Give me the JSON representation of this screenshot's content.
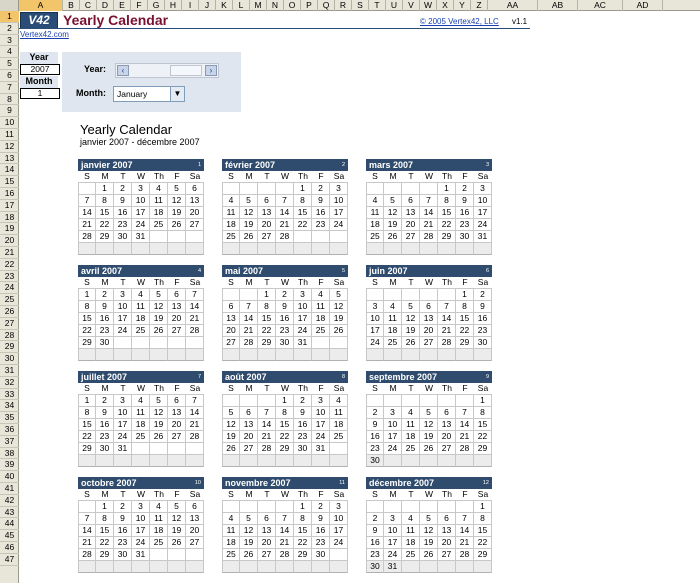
{
  "sheet": {
    "columns": [
      "A",
      "B",
      "C",
      "D",
      "E",
      "F",
      "G",
      "H",
      "I",
      "J",
      "K",
      "L",
      "M",
      "N",
      "O",
      "P",
      "Q",
      "R",
      "S",
      "T",
      "U",
      "V",
      "W",
      "X",
      "Y",
      "Z",
      "AA",
      "AB",
      "AC",
      "AD"
    ],
    "selected_column": "A",
    "rows": [
      "1",
      "2",
      "3",
      "4",
      "5",
      "6",
      "7",
      "8",
      "9",
      "10",
      "11",
      "12",
      "13",
      "14",
      "15",
      "16",
      "17",
      "18",
      "19",
      "20",
      "21",
      "22",
      "23",
      "24",
      "25",
      "26",
      "27",
      "28",
      "29",
      "30",
      "31",
      "32",
      "33",
      "34",
      "35",
      "36",
      "37",
      "38",
      "39",
      "40",
      "41",
      "42",
      "43",
      "44",
      "45",
      "46",
      "47"
    ],
    "selected_row": "1"
  },
  "header": {
    "logo_text": "V42",
    "title": "Yearly Calendar",
    "copyright": "© 2005 Vertex42, LLC",
    "version": "v1.1",
    "link": "Vertex42.com"
  },
  "side": {
    "year_label": "Year",
    "year_value": "2007",
    "month_label": "Month",
    "month_value": "1"
  },
  "controls": {
    "year_label": "Year:",
    "month_label": "Month:",
    "month_selected": "January",
    "left_arrow": "‹",
    "right_arrow": "›",
    "dropdown_arrow": "▼"
  },
  "calendar": {
    "title": "Yearly Calendar",
    "subtitle": "janvier 2007 - décembre 2007",
    "weekdays": [
      "S",
      "M",
      "T",
      "W",
      "Th",
      "F",
      "Sa"
    ],
    "months": [
      {
        "name": "janvier 2007",
        "num": "1",
        "weeks": [
          [
            "",
            "1",
            "2",
            "3",
            "4",
            "5",
            "6"
          ],
          [
            "7",
            "8",
            "9",
            "10",
            "11",
            "12",
            "13"
          ],
          [
            "14",
            "15",
            "16",
            "17",
            "18",
            "19",
            "20"
          ],
          [
            "21",
            "22",
            "23",
            "24",
            "25",
            "26",
            "27"
          ],
          [
            "28",
            "29",
            "30",
            "31",
            "",
            "",
            ""
          ],
          [
            "",
            "",
            "",
            "",
            "",
            "",
            ""
          ]
        ]
      },
      {
        "name": "février 2007",
        "num": "2",
        "weeks": [
          [
            "",
            "",
            "",
            "",
            "1",
            "2",
            "3"
          ],
          [
            "4",
            "5",
            "6",
            "7",
            "8",
            "9",
            "10"
          ],
          [
            "11",
            "12",
            "13",
            "14",
            "15",
            "16",
            "17"
          ],
          [
            "18",
            "19",
            "20",
            "21",
            "22",
            "23",
            "24"
          ],
          [
            "25",
            "26",
            "27",
            "28",
            "",
            "",
            ""
          ],
          [
            "",
            "",
            "",
            "",
            "",
            "",
            ""
          ]
        ]
      },
      {
        "name": "mars 2007",
        "num": "3",
        "weeks": [
          [
            "",
            "",
            "",
            "",
            "1",
            "2",
            "3"
          ],
          [
            "4",
            "5",
            "6",
            "7",
            "8",
            "9",
            "10"
          ],
          [
            "11",
            "12",
            "13",
            "14",
            "15",
            "16",
            "17"
          ],
          [
            "18",
            "19",
            "20",
            "21",
            "22",
            "23",
            "24"
          ],
          [
            "25",
            "26",
            "27",
            "28",
            "29",
            "30",
            "31"
          ],
          [
            "",
            "",
            "",
            "",
            "",
            "",
            ""
          ]
        ]
      },
      {
        "name": "avril 2007",
        "num": "4",
        "weeks": [
          [
            "1",
            "2",
            "3",
            "4",
            "5",
            "6",
            "7"
          ],
          [
            "8",
            "9",
            "10",
            "11",
            "12",
            "13",
            "14"
          ],
          [
            "15",
            "16",
            "17",
            "18",
            "19",
            "20",
            "21"
          ],
          [
            "22",
            "23",
            "24",
            "25",
            "26",
            "27",
            "28"
          ],
          [
            "29",
            "30",
            "",
            "",
            "",
            "",
            ""
          ],
          [
            "",
            "",
            "",
            "",
            "",
            "",
            ""
          ]
        ]
      },
      {
        "name": "mai 2007",
        "num": "5",
        "weeks": [
          [
            "",
            "",
            "1",
            "2",
            "3",
            "4",
            "5"
          ],
          [
            "6",
            "7",
            "8",
            "9",
            "10",
            "11",
            "12"
          ],
          [
            "13",
            "14",
            "15",
            "16",
            "17",
            "18",
            "19"
          ],
          [
            "20",
            "21",
            "22",
            "23",
            "24",
            "25",
            "26"
          ],
          [
            "27",
            "28",
            "29",
            "30",
            "31",
            "",
            ""
          ],
          [
            "",
            "",
            "",
            "",
            "",
            "",
            ""
          ]
        ]
      },
      {
        "name": "juin 2007",
        "num": "6",
        "weeks": [
          [
            "",
            "",
            "",
            "",
            "",
            "1",
            "2"
          ],
          [
            "3",
            "4",
            "5",
            "6",
            "7",
            "8",
            "9"
          ],
          [
            "10",
            "11",
            "12",
            "13",
            "14",
            "15",
            "16"
          ],
          [
            "17",
            "18",
            "19",
            "20",
            "21",
            "22",
            "23"
          ],
          [
            "24",
            "25",
            "26",
            "27",
            "28",
            "29",
            "30"
          ],
          [
            "",
            "",
            "",
            "",
            "",
            "",
            ""
          ]
        ]
      },
      {
        "name": "juillet 2007",
        "num": "7",
        "weeks": [
          [
            "1",
            "2",
            "3",
            "4",
            "5",
            "6",
            "7"
          ],
          [
            "8",
            "9",
            "10",
            "11",
            "12",
            "13",
            "14"
          ],
          [
            "15",
            "16",
            "17",
            "18",
            "19",
            "20",
            "21"
          ],
          [
            "22",
            "23",
            "24",
            "25",
            "26",
            "27",
            "28"
          ],
          [
            "29",
            "30",
            "31",
            "",
            "",
            "",
            ""
          ],
          [
            "",
            "",
            "",
            "",
            "",
            "",
            ""
          ]
        ]
      },
      {
        "name": "août 2007",
        "num": "8",
        "weeks": [
          [
            "",
            "",
            "",
            "1",
            "2",
            "3",
            "4"
          ],
          [
            "5",
            "6",
            "7",
            "8",
            "9",
            "10",
            "11"
          ],
          [
            "12",
            "13",
            "14",
            "15",
            "16",
            "17",
            "18"
          ],
          [
            "19",
            "20",
            "21",
            "22",
            "23",
            "24",
            "25"
          ],
          [
            "26",
            "27",
            "28",
            "29",
            "30",
            "31",
            ""
          ],
          [
            "",
            "",
            "",
            "",
            "",
            "",
            ""
          ]
        ]
      },
      {
        "name": "septembre 2007",
        "num": "9",
        "weeks": [
          [
            "",
            "",
            "",
            "",
            "",
            "",
            "1"
          ],
          [
            "2",
            "3",
            "4",
            "5",
            "6",
            "7",
            "8"
          ],
          [
            "9",
            "10",
            "11",
            "12",
            "13",
            "14",
            "15"
          ],
          [
            "16",
            "17",
            "18",
            "19",
            "20",
            "21",
            "22"
          ],
          [
            "23",
            "24",
            "25",
            "26",
            "27",
            "28",
            "29"
          ],
          [
            "30",
            "",
            "",
            "",
            "",
            "",
            ""
          ]
        ]
      },
      {
        "name": "octobre 2007",
        "num": "10",
        "weeks": [
          [
            "",
            "1",
            "2",
            "3",
            "4",
            "5",
            "6"
          ],
          [
            "7",
            "8",
            "9",
            "10",
            "11",
            "12",
            "13"
          ],
          [
            "14",
            "15",
            "16",
            "17",
            "18",
            "19",
            "20"
          ],
          [
            "21",
            "22",
            "23",
            "24",
            "25",
            "26",
            "27"
          ],
          [
            "28",
            "29",
            "30",
            "31",
            "",
            "",
            ""
          ],
          [
            "",
            "",
            "",
            "",
            "",
            "",
            ""
          ]
        ]
      },
      {
        "name": "novembre 2007",
        "num": "11",
        "weeks": [
          [
            "",
            "",
            "",
            "",
            "1",
            "2",
            "3"
          ],
          [
            "4",
            "5",
            "6",
            "7",
            "8",
            "9",
            "10"
          ],
          [
            "11",
            "12",
            "13",
            "14",
            "15",
            "16",
            "17"
          ],
          [
            "18",
            "19",
            "20",
            "21",
            "22",
            "23",
            "24"
          ],
          [
            "25",
            "26",
            "27",
            "28",
            "29",
            "30",
            ""
          ],
          [
            "",
            "",
            "",
            "",
            "",
            "",
            ""
          ]
        ]
      },
      {
        "name": "décembre 2007",
        "num": "12",
        "weeks": [
          [
            "",
            "",
            "",
            "",
            "",
            "",
            "1"
          ],
          [
            "2",
            "3",
            "4",
            "5",
            "6",
            "7",
            "8"
          ],
          [
            "9",
            "10",
            "11",
            "12",
            "13",
            "14",
            "15"
          ],
          [
            "16",
            "17",
            "18",
            "19",
            "20",
            "21",
            "22"
          ],
          [
            "23",
            "24",
            "25",
            "26",
            "27",
            "28",
            "29"
          ],
          [
            "30",
            "31",
            "",
            "",
            "",
            "",
            ""
          ]
        ]
      }
    ]
  }
}
